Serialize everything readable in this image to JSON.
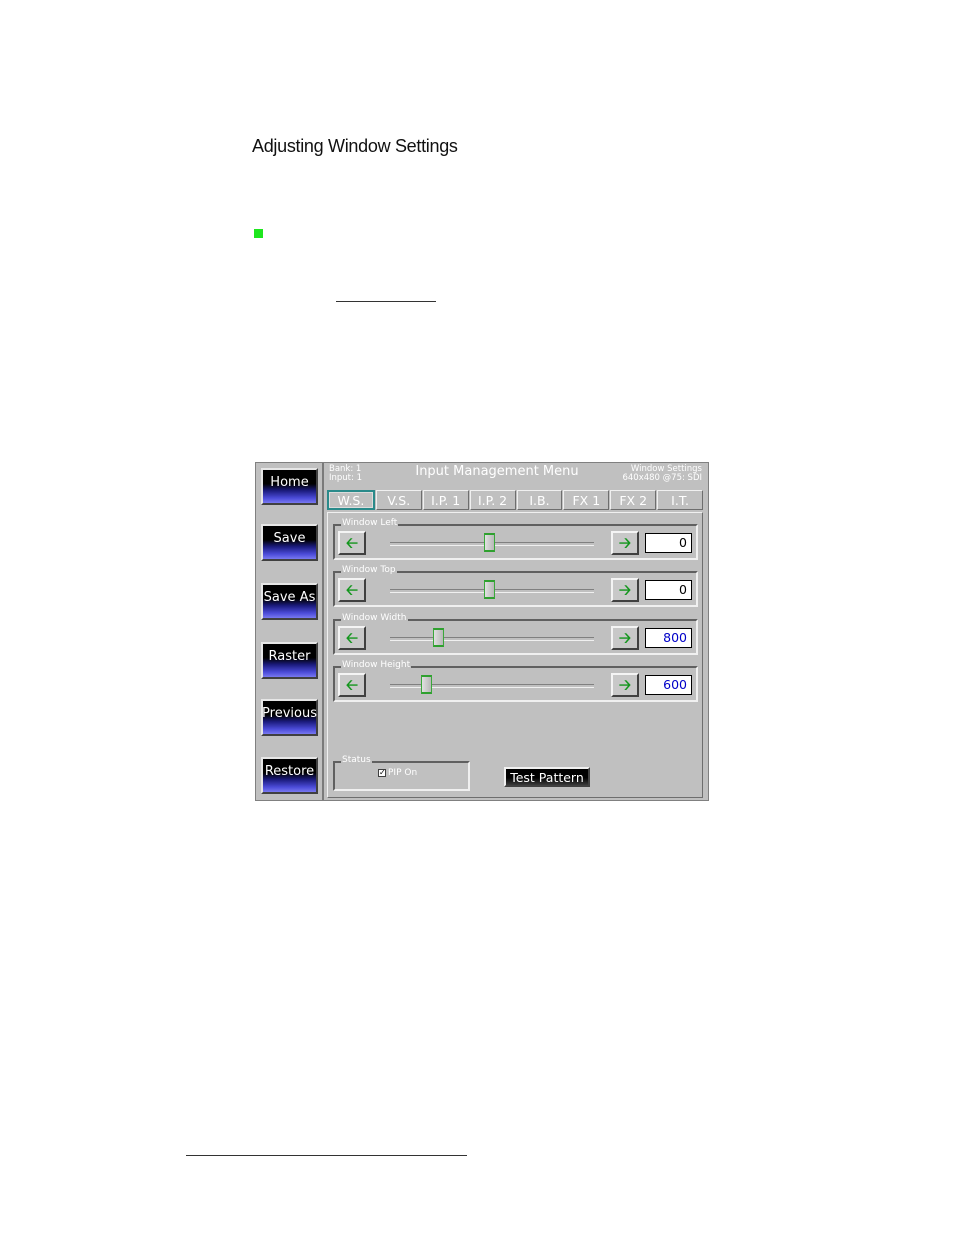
{
  "doc": {
    "heading": "Adjusting Window Settings"
  },
  "sidebar": {
    "buttons": [
      {
        "label": "Home"
      },
      {
        "label": "Save"
      },
      {
        "label": "Save As"
      },
      {
        "label": "Raster"
      },
      {
        "label": "Previous"
      },
      {
        "label": "Restore"
      }
    ]
  },
  "header": {
    "bank": "Bank: 1",
    "input": "Input: 1",
    "title": "Input Management Menu",
    "mode": "Window Settings",
    "format": "640x480 @75: SDI"
  },
  "tabs": [
    {
      "label": "W.S.",
      "active": true
    },
    {
      "label": "V.S."
    },
    {
      "label": "I.P. 1"
    },
    {
      "label": "I.P. 2"
    },
    {
      "label": "I.B."
    },
    {
      "label": "FX 1"
    },
    {
      "label": "FX 2"
    },
    {
      "label": "I.T."
    }
  ],
  "sliders": [
    {
      "label": "Window Left",
      "value": "0",
      "position": 0.49
    },
    {
      "label": "Window Top",
      "value": "0",
      "position": 0.49
    },
    {
      "label": "Window Width",
      "value": "800",
      "position": 0.24
    },
    {
      "label": "Window Height",
      "value": "600",
      "position": 0.18
    }
  ],
  "status": {
    "label": "Status",
    "pip_label": "PIP On",
    "pip_checked": true,
    "check_glyph": "✓"
  },
  "actions": {
    "test_pattern": "Test Pattern"
  },
  "icons": {
    "left": "left-arrow-icon",
    "right": "right-arrow-icon"
  },
  "colors": {
    "accent_green": "#14961e",
    "bullet_green": "#1ee61e",
    "value_blue": "#0000c8"
  }
}
